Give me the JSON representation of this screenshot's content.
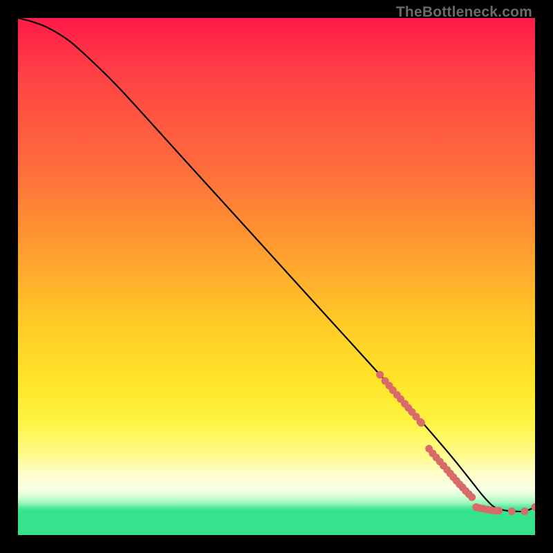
{
  "watermark": "TheBottleneck.com",
  "chart_data": {
    "type": "line",
    "title": "",
    "xlabel": "",
    "ylabel": "",
    "xlim": [
      0,
      100
    ],
    "ylim": [
      0,
      100
    ],
    "series": [
      {
        "name": "curve",
        "x": [
          0,
          3,
          6,
          10,
          15,
          20,
          30,
          40,
          50,
          60,
          70,
          78,
          84,
          88,
          90,
          92,
          94,
          96,
          98,
          100
        ],
        "y": [
          100,
          99.2,
          98,
          95.5,
          91,
          86,
          75,
          64,
          53,
          42,
          31,
          22,
          15,
          10,
          7.5,
          5.5,
          4.8,
          4.6,
          4.6,
          5.4
        ]
      }
    ],
    "points": [
      {
        "x": 70.0,
        "y": 31.0
      },
      {
        "x": 71.0,
        "y": 29.8
      },
      {
        "x": 71.8,
        "y": 28.9
      },
      {
        "x": 72.5,
        "y": 28.0
      },
      {
        "x": 73.3,
        "y": 27.1
      },
      {
        "x": 74.0,
        "y": 26.3
      },
      {
        "x": 74.8,
        "y": 25.4
      },
      {
        "x": 75.5,
        "y": 24.6
      },
      {
        "x": 76.2,
        "y": 23.8
      },
      {
        "x": 77.0,
        "y": 22.9
      },
      {
        "x": 77.8,
        "y": 21.9
      },
      {
        "x": 78.0,
        "y": 21.7
      },
      {
        "x": 79.5,
        "y": 16.7
      },
      {
        "x": 80.2,
        "y": 15.8
      },
      {
        "x": 80.9,
        "y": 15.0
      },
      {
        "x": 81.6,
        "y": 14.2
      },
      {
        "x": 82.3,
        "y": 13.4
      },
      {
        "x": 83.0,
        "y": 12.6
      },
      {
        "x": 83.6,
        "y": 11.9
      },
      {
        "x": 84.2,
        "y": 11.2
      },
      {
        "x": 84.8,
        "y": 10.5
      },
      {
        "x": 85.4,
        "y": 9.8
      },
      {
        "x": 86.0,
        "y": 9.2
      },
      {
        "x": 86.6,
        "y": 8.5
      },
      {
        "x": 87.2,
        "y": 7.9
      },
      {
        "x": 87.8,
        "y": 7.3
      },
      {
        "x": 88.6,
        "y": 5.4
      },
      {
        "x": 89.3,
        "y": 5.2
      },
      {
        "x": 90.0,
        "y": 5.1
      },
      {
        "x": 90.8,
        "y": 4.9
      },
      {
        "x": 91.6,
        "y": 4.8
      },
      {
        "x": 92.4,
        "y": 4.7
      },
      {
        "x": 93.0,
        "y": 4.7
      },
      {
        "x": 95.5,
        "y": 4.6
      },
      {
        "x": 98.0,
        "y": 4.6
      },
      {
        "x": 100.0,
        "y": 5.4
      }
    ],
    "point_color": "#d86a6a",
    "curve_color": "#000000",
    "gradient_stops": [
      {
        "pos": 0.0,
        "color": "#ff1a4a"
      },
      {
        "pos": 0.12,
        "color": "#ff4444"
      },
      {
        "pos": 0.28,
        "color": "#ff6a3c"
      },
      {
        "pos": 0.44,
        "color": "#ff9a30"
      },
      {
        "pos": 0.58,
        "color": "#ffc828"
      },
      {
        "pos": 0.7,
        "color": "#ffe428"
      },
      {
        "pos": 0.78,
        "color": "#fff340"
      },
      {
        "pos": 0.845,
        "color": "#fffb8a"
      },
      {
        "pos": 0.885,
        "color": "#fffed0"
      },
      {
        "pos": 0.91,
        "color": "#f7ffe6"
      },
      {
        "pos": 0.925,
        "color": "#d8ffd8"
      },
      {
        "pos": 0.938,
        "color": "#9cf5bd"
      },
      {
        "pos": 0.946,
        "color": "#5ce9a0"
      },
      {
        "pos": 0.952,
        "color": "#34e38c"
      },
      {
        "pos": 1.0,
        "color": "#34e38c"
      }
    ]
  }
}
